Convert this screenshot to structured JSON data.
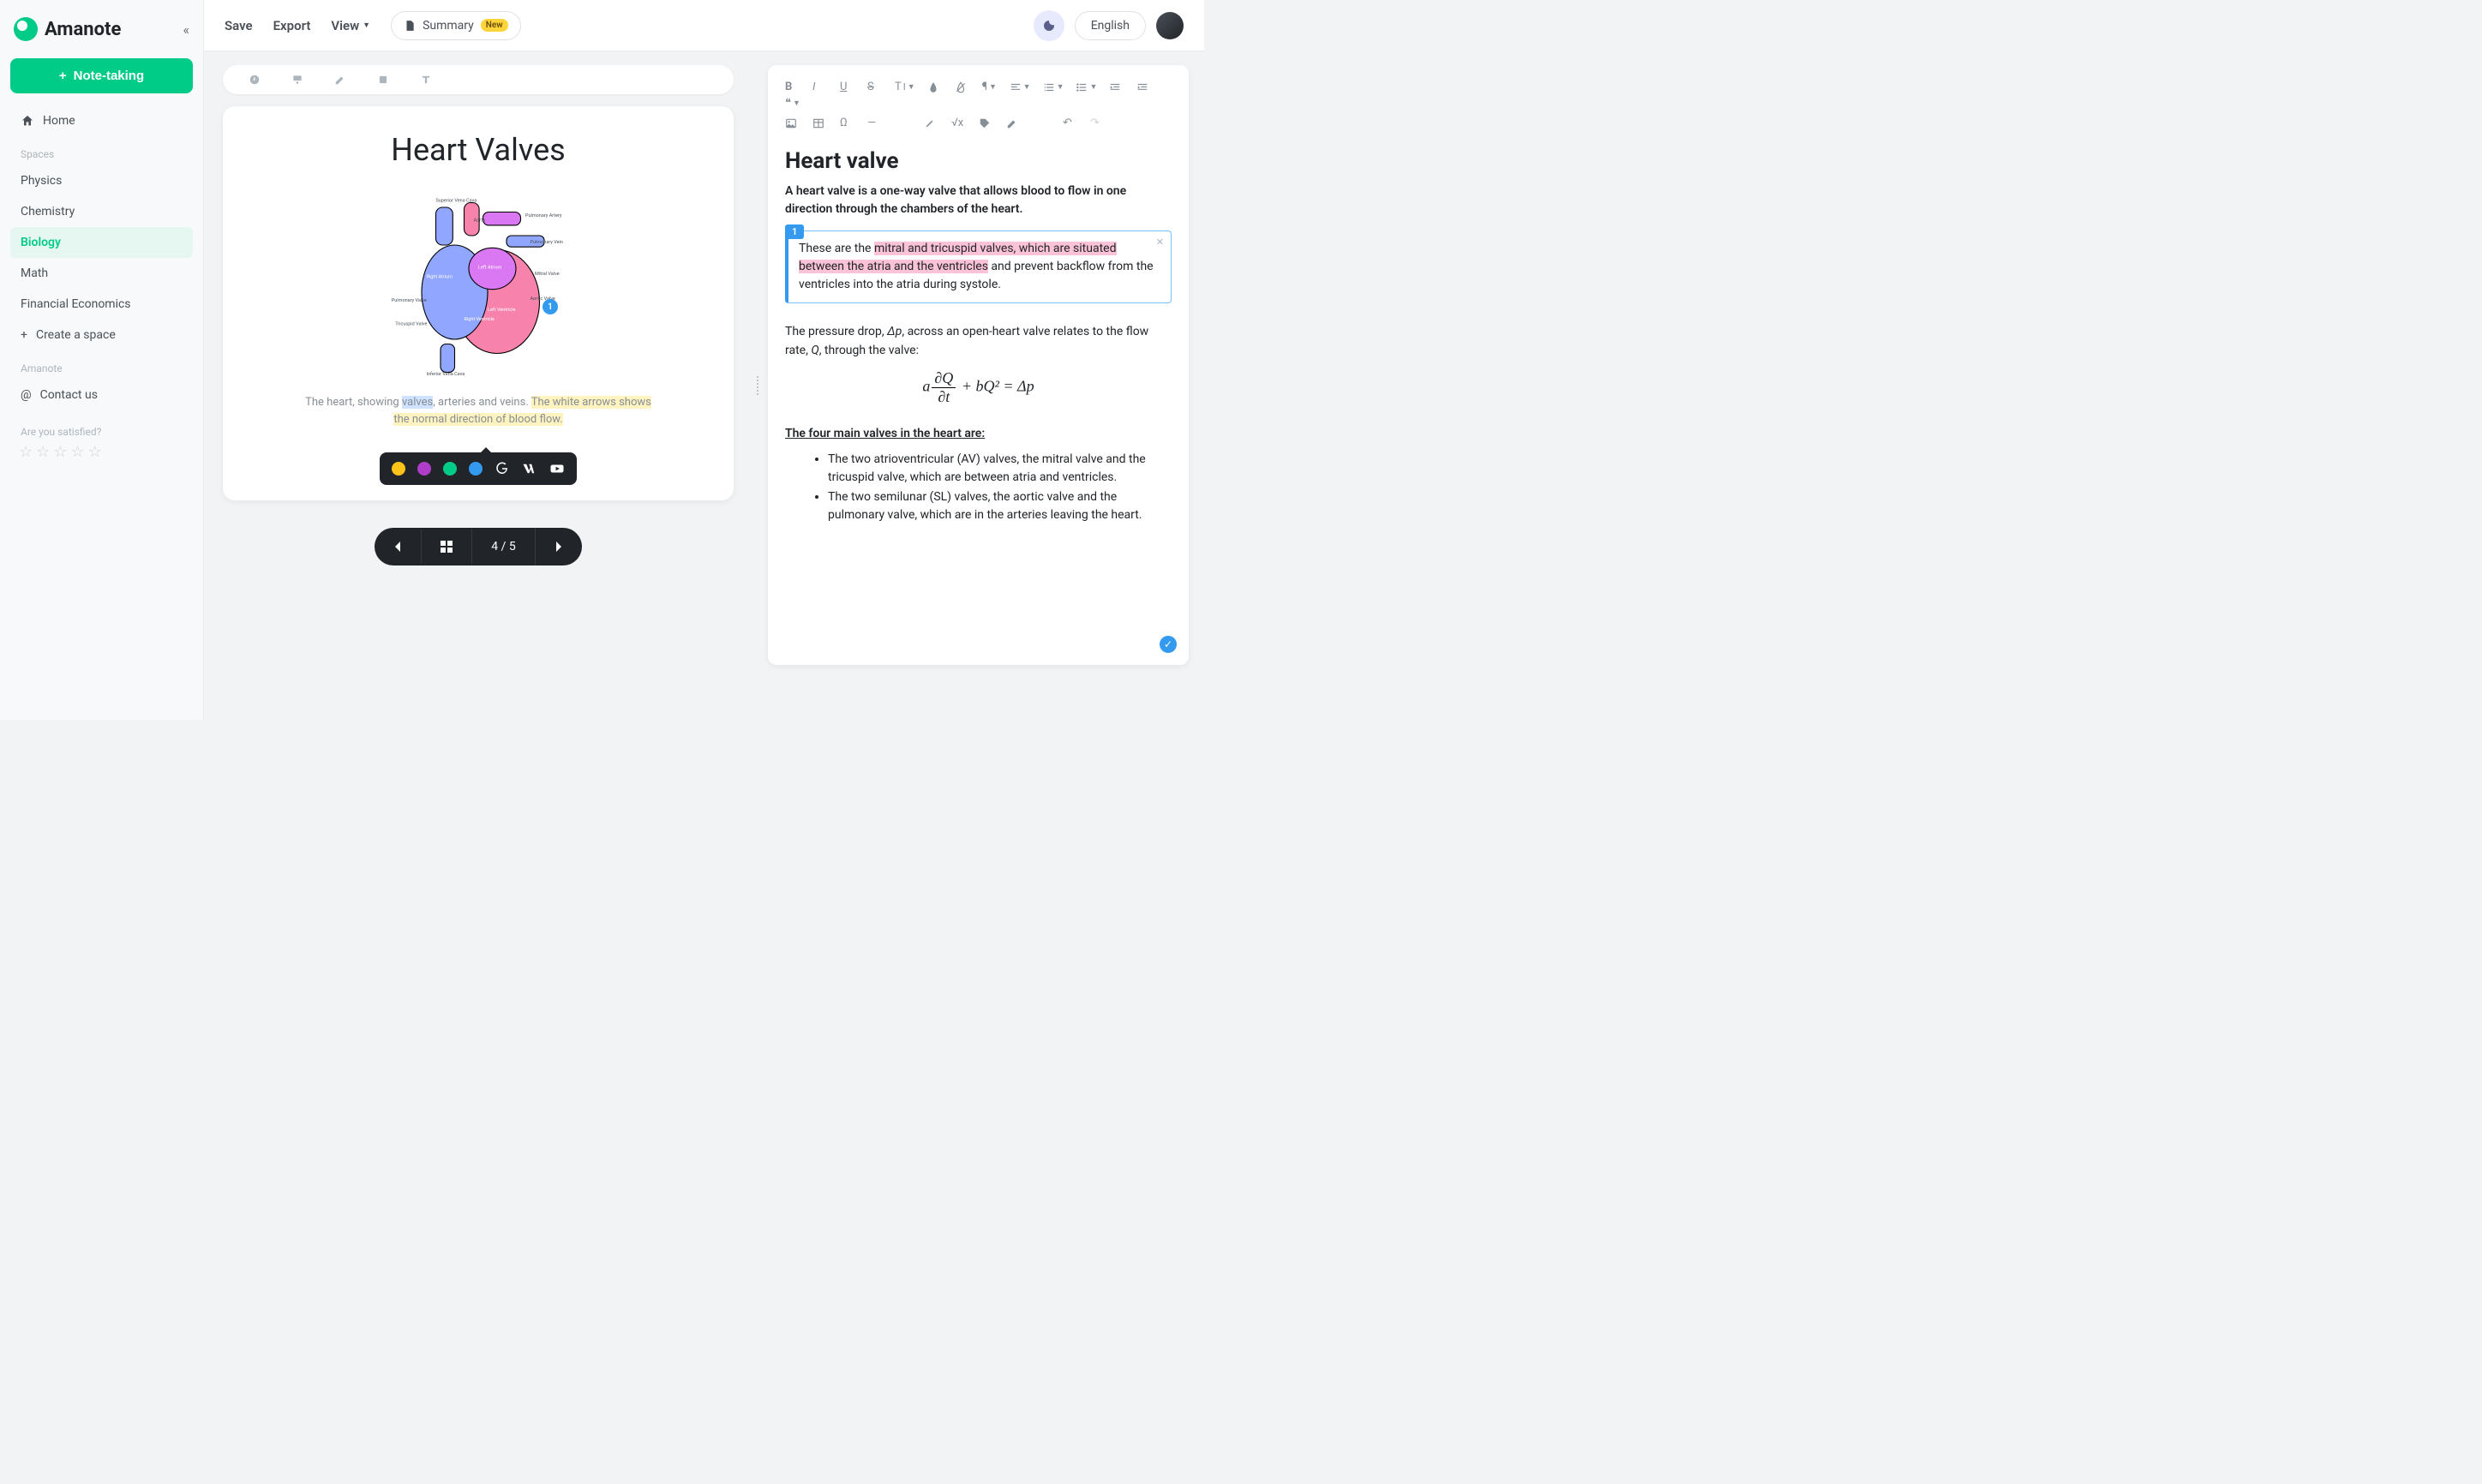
{
  "brand": "Amanote",
  "sidebar": {
    "note_taking": "Note-taking",
    "home": "Home",
    "spaces_label": "Spaces",
    "spaces": [
      "Physics",
      "Chemistry",
      "Biology",
      "Math",
      "Financial Economics"
    ],
    "active_space_index": 2,
    "create_space": "Create a space",
    "amanote_label": "Amanote",
    "contact": "Contact us",
    "satisfied": "Are you satisfied?"
  },
  "topbar": {
    "save": "Save",
    "export": "Export",
    "view": "View",
    "summary": "Summary",
    "badge_new": "New",
    "language": "English"
  },
  "document": {
    "title": "Heart Valves",
    "marker": "1",
    "heart_labels": {
      "svc": "Superior Vena Cava",
      "aorta": "Aorta",
      "pa": "Pulmonary Artery",
      "pv": "Pulmonary Vein",
      "mv": "Mitral Valve",
      "av": "Aortic Valve",
      "ra": "Right Atrium",
      "la": "Left Atrium",
      "rv": "Right Ventricle",
      "lv": "Left Ventricle",
      "tv": "Tricuspid Valve",
      "pvlv": "Pulmonary Valve",
      "ivc": "Inferior Vena Cava"
    },
    "caption_prefix": "The heart, showing ",
    "caption_hl1": "valves",
    "caption_mid": ", arteries and veins. ",
    "caption_hl2": "The white arrows shows the normal direction of blood flow.",
    "pager": "4 / 5",
    "popup_colors": [
      "#fcc419",
      "#ae3ec9",
      "#00cc88",
      "#339af0"
    ]
  },
  "notes": {
    "title": "Heart valve",
    "intro": "A heart valve is a one-way valve that allows blood to flow in one direction through the chambers of the heart.",
    "ref_num": "1",
    "ref_pre": "These are the ",
    "ref_hl": "mitral and tricuspid valves, which are situated between the atria and the ventricles",
    "ref_post": " and prevent backflow from the ventricles into the atria during systole.",
    "pressure_pre": "The pressure drop, ",
    "dp": "Δp",
    "pressure_mid": ", across an open-heart valve relates to the flow rate, ",
    "Q": "Q",
    "pressure_post": ", through the valve:",
    "equation": "a ∂Q/∂t + bQ² = Δp",
    "four_heading": "The four main valves in the heart are:",
    "valve_items": [
      "The two atrioventricular (AV) valves, the mitral valve and the tricuspid valve, which are between atria and ventricles.",
      "The two semilunar (SL) valves, the aortic valve and the pulmonary valve, which are in the arteries leaving the heart."
    ]
  }
}
